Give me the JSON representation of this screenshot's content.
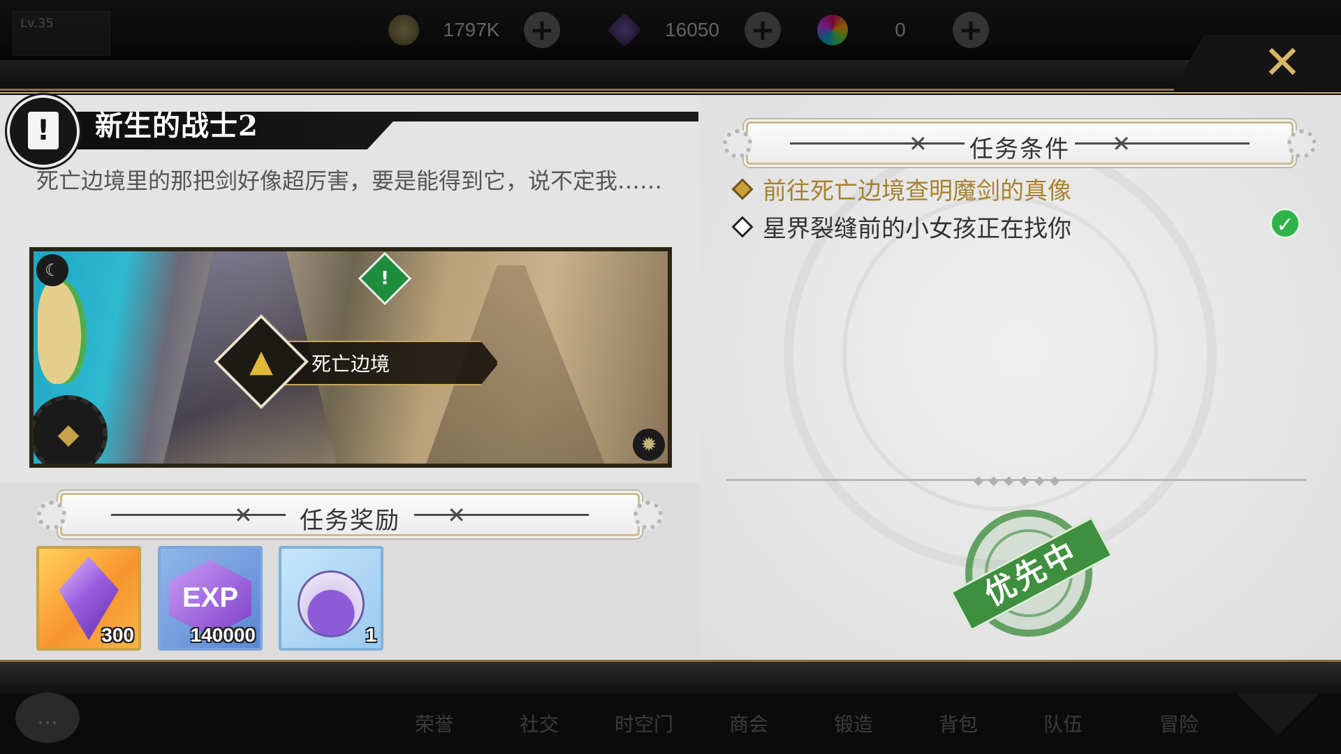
{
  "top_bar": {
    "level": "Lv.35",
    "resources": [
      {
        "icon": "gold-coin-icon",
        "value": "1797K"
      },
      {
        "icon": "purple-gem-icon",
        "value": "16050"
      },
      {
        "icon": "rainbow-orb-icon",
        "value": "0"
      }
    ],
    "add_icon": "plus-icon"
  },
  "dialog": {
    "close_icon": "close-x-icon",
    "quest": {
      "title": "新生的战士2",
      "description": "死亡边境里的那把剑好像超厉害，要是能得到它，说不定我……",
      "map_location": "死亡边境"
    },
    "conditions": {
      "header": "任务条件",
      "items": [
        {
          "text": "前往死亡边境查明魔剑的真像",
          "done": false,
          "color": "#a6822f"
        },
        {
          "text": "星界裂缝前的小女孩正在找你",
          "done": true,
          "color": "#333333"
        }
      ],
      "stamp": "优先中"
    },
    "rewards": {
      "header": "任务奖励",
      "items": [
        {
          "icon": "purple-crystal-icon",
          "qty": "300"
        },
        {
          "icon": "exp-crystal-icon",
          "label": "EXP",
          "qty": "140000"
        },
        {
          "icon": "potion-bottle-icon",
          "qty": "1"
        }
      ]
    }
  },
  "bottom_nav": {
    "items": [
      "荣誉",
      "社交",
      "时空门",
      "商会",
      "锻造",
      "背包",
      "队伍",
      "冒险"
    ]
  }
}
